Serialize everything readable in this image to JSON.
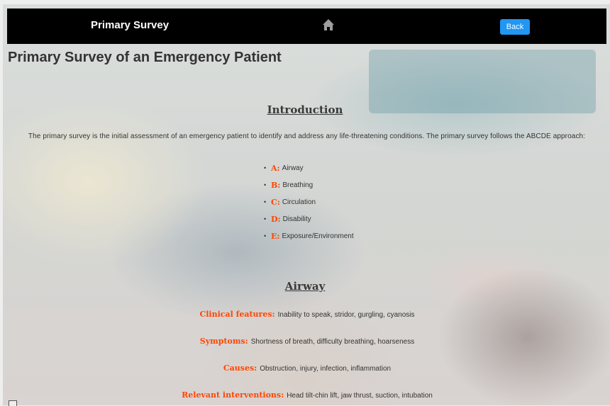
{
  "navbar": {
    "title": "Primary Survey",
    "home_icon": "home-icon",
    "back_label": "Back",
    "back_color": "#2196f3"
  },
  "page_title": "Primary Survey of an Emergency Patient",
  "accent_color": "#ff4500",
  "introduction": {
    "heading": "Introduction",
    "text": "The primary survey is the initial assessment of an emergency patient to identify and address any life-threatening conditions. The primary survey follows the ABCDE approach:",
    "items": [
      {
        "letter": "A:",
        "text": "Airway"
      },
      {
        "letter": "B:",
        "text": "Breathing"
      },
      {
        "letter": "C:",
        "text": "Circulation"
      },
      {
        "letter": "D:",
        "text": "Disability"
      },
      {
        "letter": "E:",
        "text": "Exposure/Environment"
      }
    ]
  },
  "airway": {
    "heading": "Airway",
    "rows": [
      {
        "label": "Clinical features:",
        "value": "Inability to speak, stridor, gurgling, cyanosis"
      },
      {
        "label": "Symptoms:",
        "value": "Shortness of breath, difficulty breathing, hoarseness"
      },
      {
        "label": "Causes:",
        "value": "Obstruction, injury, infection, inflammation"
      },
      {
        "label": "Relevant interventions:",
        "value": "Head tilt-chin lift, jaw thrust, suction, intubation"
      }
    ]
  }
}
